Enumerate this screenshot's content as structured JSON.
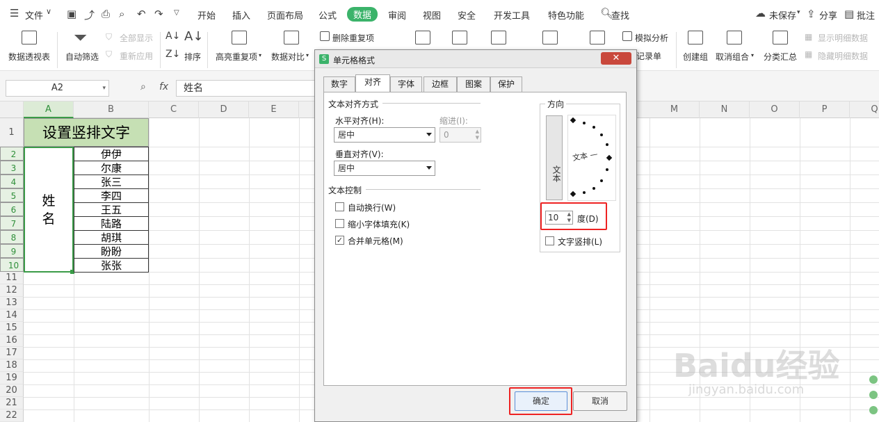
{
  "menubar": {
    "file": "文件",
    "tabs": [
      "开始",
      "插入",
      "页面布局",
      "公式",
      "数据",
      "审阅",
      "视图",
      "安全",
      "开发工具",
      "特色功能"
    ],
    "active_tab": "数据",
    "search": "查找",
    "unsaved": "未保存",
    "share": "分享",
    "comment": "批注"
  },
  "ribbon": {
    "pivot": "数据透视表",
    "autofilter": "自动筛选",
    "show_all": "全部显示",
    "reapply": "重新应用",
    "sort": "排序",
    "highlight_dup": "高亮重复项",
    "data_compare": "数据对比",
    "remove_dup": "删除重复项",
    "whatif": "模拟分析",
    "record": "记录单",
    "group": "创建组",
    "ungroup": "取消组合",
    "subtotal": "分类汇总",
    "show_detail": "显示明细数据",
    "hide_detail": "隐藏明细数据"
  },
  "formula_bar": {
    "name_box": "A2",
    "fx": "fx",
    "content": "姓名"
  },
  "sheet": {
    "columns": [
      "A",
      "B",
      "C",
      "D",
      "E",
      "M",
      "N",
      "O",
      "P",
      "Q"
    ],
    "rows": [
      "1",
      "2",
      "3",
      "4",
      "5",
      "6",
      "7",
      "8",
      "9",
      "10",
      "11",
      "12",
      "13",
      "14",
      "15",
      "16",
      "17",
      "18",
      "19",
      "20",
      "21",
      "22"
    ],
    "title": "设置竖排文字",
    "merged_label": "姓\n名",
    "names": [
      "伊伊",
      "尔康",
      "张三",
      "李四",
      "王五",
      "陆路",
      "胡琪",
      "盼盼",
      "张张"
    ]
  },
  "dialog": {
    "title": "单元格格式",
    "tabs": [
      "数字",
      "对齐",
      "字体",
      "边框",
      "图案",
      "保护"
    ],
    "active_tab": "对齐",
    "text_align_section": "文本对齐方式",
    "h_align_label": "水平对齐(H):",
    "h_align_value": "居中",
    "indent_label": "缩进(I):",
    "indent_value": "0",
    "v_align_label": "垂直对齐(V):",
    "v_align_value": "居中",
    "text_control_section": "文本控制",
    "wrap_label": "自动换行(W)",
    "wrap_checked": false,
    "shrink_label": "缩小字体填充(K)",
    "shrink_checked": false,
    "merge_label": "合并单元格(M)",
    "merge_checked": true,
    "orientation_section": "方向",
    "vertical_text_sample": "文本",
    "dial_text": "文本 —",
    "degrees_value": "10",
    "degrees_label": "度(D)",
    "vertical_label": "文字竖排(L)",
    "vertical_checked": false,
    "ok": "确定",
    "cancel": "取消"
  },
  "watermark": {
    "brand": "Baidu经验",
    "url": "jingyan.baidu.com"
  },
  "colors": {
    "accent": "#3bb36a",
    "selection": "#3a9b47",
    "header_fill": "#c6e0b4",
    "highlight": "#e22222"
  }
}
